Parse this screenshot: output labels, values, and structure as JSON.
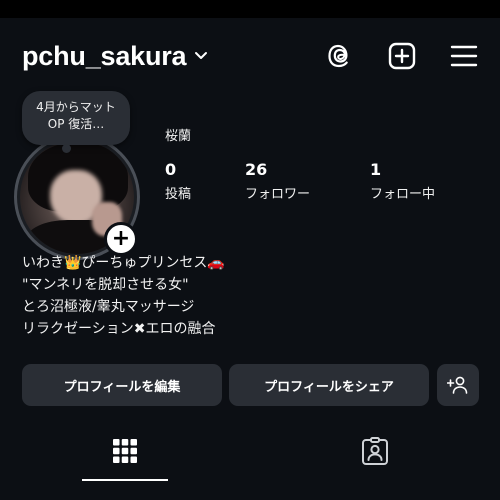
{
  "profile": {
    "username": "pchu_sakura",
    "display_name": "桜蘭",
    "note_text": "4月からマット OP 復活…",
    "stats": [
      {
        "value": "0",
        "label": "投稿"
      },
      {
        "value": "26",
        "label": "フォロワー"
      },
      {
        "value": "1",
        "label": "フォロー中"
      }
    ],
    "bio_lines": [
      "いわき👑ぴーちゅプリンセス🚗",
      "\"マンネリを脱却させる女\"",
      "とろ沼極液/睾丸マッサージ",
      "リラクゼーション✖エロの融合"
    ]
  },
  "buttons": {
    "edit_profile": "プロフィールを編集",
    "share_profile": "プロフィールをシェア"
  },
  "icons": {
    "header": [
      "threads-icon",
      "new-post-icon",
      "menu-icon"
    ],
    "tabs": [
      "grid-icon",
      "tagged-icon"
    ],
    "add_person": "add-person-icon"
  },
  "colors": {
    "background": "#0c0f14",
    "button": "#2a2e35",
    "text": "#f5f5f5"
  }
}
